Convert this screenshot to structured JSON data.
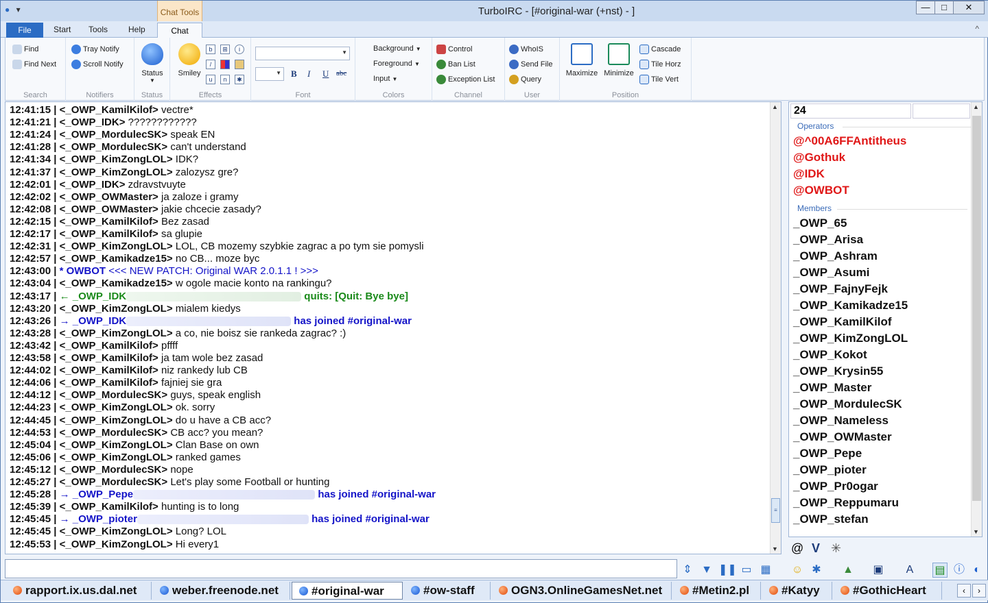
{
  "window": {
    "title": "TurboIRC - [#original-war (+nst) - ]",
    "context_tab": "Chat Tools",
    "buttons": {
      "minimize": "—",
      "maximize": "□",
      "close": "✕"
    }
  },
  "ribbon_tabs": [
    "File",
    "Start",
    "Tools",
    "Help",
    "Chat"
  ],
  "ribbon": {
    "search": {
      "label": "Search",
      "find": "Find",
      "find_next": "Find Next"
    },
    "notifiers": {
      "label": "Notifiers",
      "tray": "Tray Notify",
      "scroll": "Scroll Notify"
    },
    "status": {
      "label": "Status",
      "button": "Status"
    },
    "effects": {
      "label": "Effects",
      "smiley": "Smiley"
    },
    "font": {
      "label": "Font",
      "bold": "B",
      "italic": "I",
      "underline": "U",
      "strike": "abc"
    },
    "colors": {
      "label": "Colors",
      "background": "Background",
      "foreground": "Foreground",
      "input": "Input"
    },
    "channel": {
      "label": "Channel",
      "control": "Control",
      "ban_list": "Ban List",
      "exception_list": "Exception List"
    },
    "user": {
      "label": "User",
      "whois": "WhoIS",
      "send_file": "Send File",
      "query": "Query"
    },
    "position": {
      "label": "Position",
      "maximize": "Maximize",
      "minimize": "Minimize",
      "cascade": "Cascade",
      "tile_horz": "Tile Horz",
      "tile_vert": "Tile Vert"
    }
  },
  "chat_lines": [
    {
      "ts": "12:41:15",
      "nick": "<_OWP_KamilKilof>",
      "msg": "vectre*"
    },
    {
      "ts": "12:41:21",
      "nick": "<_OWP_IDK>",
      "msg": "????????????"
    },
    {
      "ts": "12:41:24",
      "nick": "<_OWP_MordulecSK>",
      "msg": "speak EN"
    },
    {
      "ts": "12:41:28",
      "nick": "<_OWP_MordulecSK>",
      "msg": "can't understand"
    },
    {
      "ts": "12:41:34",
      "nick": "<_OWP_KimZongLOL>",
      "msg": "IDK?"
    },
    {
      "ts": "12:41:37",
      "nick": "<_OWP_KimZongLOL>",
      "msg": "zalozysz gre?"
    },
    {
      "ts": "12:42:01",
      "nick": "<_OWP_IDK>",
      "msg": "zdravstvuyte"
    },
    {
      "ts": "12:42:02",
      "nick": "<_OWP_OWMaster>",
      "msg": "ja zaloze i gramy"
    },
    {
      "ts": "12:42:08",
      "nick": "<_OWP_OWMaster>",
      "msg": "jakie chcecie zasady?"
    },
    {
      "ts": "12:42:15",
      "nick": "<_OWP_KamilKilof>",
      "msg": "Bez zasad"
    },
    {
      "ts": "12:42:17",
      "nick": "<_OWP_KamilKilof>",
      "msg": "sa glupie"
    },
    {
      "ts": "12:42:31",
      "nick": "<_OWP_KimZongLOL>",
      "msg": "LOL, CB mozemy szybkie zagrac a po tym sie pomysli"
    },
    {
      "ts": "12:42:57",
      "nick": "<_OWP_Kamikadze15>",
      "msg": "no CB... moze byc"
    },
    {
      "ts": "12:43:00",
      "nick": "* OWBOT",
      "msg": "<<< NEW PATCH: Original WAR 2.0.1.1 ! >>>",
      "kind": "action"
    },
    {
      "ts": "12:43:04",
      "nick": "<_OWP_Kamikadze15>",
      "msg": "w ogole macie konto na rankingu?"
    },
    {
      "ts": "12:43:17",
      "nick": "← _OWP_IDK",
      "msg": "quits: [Quit: Bye bye]",
      "kind": "quit"
    },
    {
      "ts": "12:43:20",
      "nick": "<_OWP_KimZongLOL>",
      "msg": "mialem kiedys"
    },
    {
      "ts": "12:43:26",
      "nick": "→ _OWP_IDK",
      "msg": "has joined #original-war",
      "kind": "join"
    },
    {
      "ts": "12:43:28",
      "nick": "<_OWP_KimZongLOL>",
      "msg": "a co, nie boisz sie rankeda zagrac? :)"
    },
    {
      "ts": "12:43:42",
      "nick": "<_OWP_KamilKilof>",
      "msg": "pffff"
    },
    {
      "ts": "12:43:58",
      "nick": "<_OWP_KamilKilof>",
      "msg": "ja tam wole bez zasad"
    },
    {
      "ts": "12:44:02",
      "nick": "<_OWP_KamilKilof>",
      "msg": "niz rankedy lub CB"
    },
    {
      "ts": "12:44:06",
      "nick": "<_OWP_KamilKilof>",
      "msg": "fajniej sie gra"
    },
    {
      "ts": "12:44:12",
      "nick": "<_OWP_MordulecSK>",
      "msg": "guys, speak english"
    },
    {
      "ts": "12:44:23",
      "nick": "<_OWP_KimZongLOL>",
      "msg": "ok. sorry"
    },
    {
      "ts": "12:44:45",
      "nick": "<_OWP_KimZongLOL>",
      "msg": "do u have a CB acc?"
    },
    {
      "ts": "12:44:53",
      "nick": "<_OWP_MordulecSK>",
      "msg": "CB acc? you mean?"
    },
    {
      "ts": "12:45:04",
      "nick": "<_OWP_KimZongLOL>",
      "msg": "Clan Base on own"
    },
    {
      "ts": "12:45:06",
      "nick": "<_OWP_KimZongLOL>",
      "msg": "ranked games"
    },
    {
      "ts": "12:45:12",
      "nick": "<_OWP_MordulecSK>",
      "msg": "nope"
    },
    {
      "ts": "12:45:27",
      "nick": "<_OWP_MordulecSK>",
      "msg": "Let's play some Football or hunting"
    },
    {
      "ts": "12:45:28",
      "nick": "→ _OWP_Pepe",
      "msg": "has joined #original-war",
      "kind": "join"
    },
    {
      "ts": "12:45:39",
      "nick": "<_OWP_KamilKilof>",
      "msg": "hunting is to long"
    },
    {
      "ts": "12:45:45",
      "nick": "→ _OWP_pioter",
      "msg": "has joined #original-war",
      "kind": "join"
    },
    {
      "ts": "12:45:45",
      "nick": "<_OWP_KimZongLOL>",
      "msg": "Long? LOL"
    },
    {
      "ts": "12:45:53",
      "nick": "<_OWP_KimZongLOL>",
      "msg": "Hi every1"
    }
  ],
  "nicklist": {
    "count": "24",
    "operators_label": "Operators",
    "members_label": "Members",
    "operators": [
      "@^00A6FFAntitheus",
      "@Gothuk",
      "@IDK",
      "@OWBOT"
    ],
    "members": [
      "_OWP_65",
      "_OWP_Arisa",
      "_OWP_Ashram",
      "_OWP_Asumi",
      "_OWP_FajnyFejk",
      "_OWP_Kamikadze15",
      "_OWP_KamilKilof",
      "_OWP_KimZongLOL",
      "_OWP_Kokot",
      "_OWP_Krysin55",
      "_OWP_Master",
      "_OWP_MordulecSK",
      "_OWP_Nameless",
      "_OWP_OWMaster",
      "_OWP_Pepe",
      "_OWP_pioter",
      "_OWP_Pr0ogar",
      "_OWP_Reppumaru",
      "_OWP_stefan"
    ]
  },
  "server_tabs": [
    {
      "label": "rapport.ix.us.dal.net",
      "color": "red"
    },
    {
      "label": "weber.freenode.net",
      "color": "blue"
    },
    {
      "label": "#original-war",
      "color": "blue",
      "active": true
    },
    {
      "label": "#ow-staff",
      "color": "blue"
    },
    {
      "label": "OGN3.OnlineGamesNet.net",
      "color": "red"
    },
    {
      "label": "#Metin2.pl",
      "color": "red"
    },
    {
      "label": "#Katyy",
      "color": "red"
    },
    {
      "label": "#GothicHeart",
      "color": "red"
    }
  ],
  "colors": {
    "nick_op": "#e01818",
    "join": "#1414c8",
    "quit": "#1a8a1a",
    "accent": "#2b6cc4"
  }
}
